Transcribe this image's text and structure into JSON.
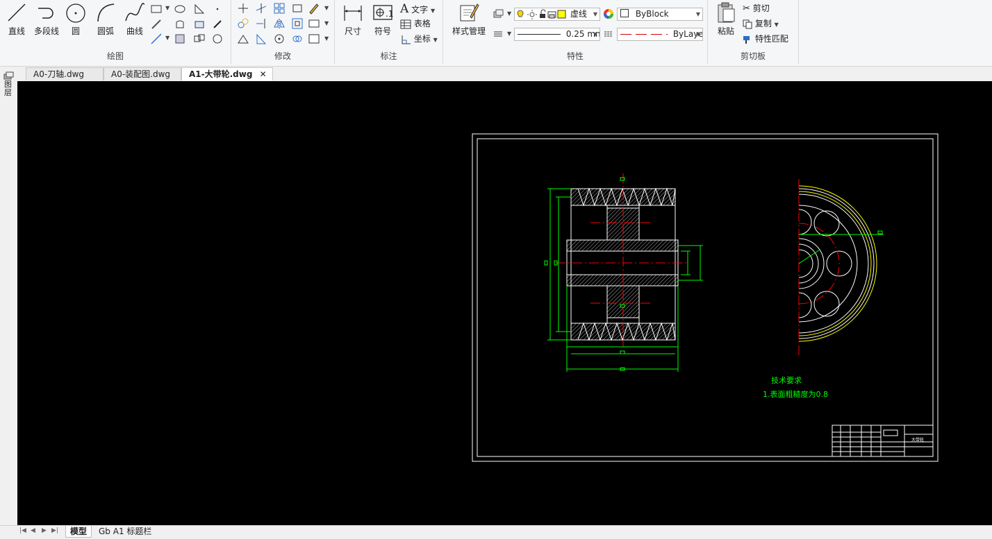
{
  "colors": {
    "ribbon_bg": "#f5f6f7",
    "canvas_bg": "#000000",
    "drawing_white": "#ffffff",
    "drawing_green": "#00ff00",
    "drawing_red": "#ff0000",
    "drawing_yellow": "#ffff00"
  },
  "ribbon": {
    "draw_group": {
      "label": "绘图",
      "buttons": [
        {
          "label": "直线",
          "icon": "line-icon"
        },
        {
          "label": "多段线",
          "icon": "polyline-icon"
        },
        {
          "label": "圆",
          "icon": "circle-icon"
        },
        {
          "label": "圆弧",
          "icon": "arc-icon"
        },
        {
          "label": "曲线",
          "icon": "spline-icon"
        }
      ]
    },
    "modify_group": {
      "label": "修改"
    },
    "annotate_group": {
      "label": "标注",
      "dimension_label": "尺寸",
      "symbol_label": "符号",
      "text_label": "文字",
      "table_label": "表格",
      "coord_label": "坐标"
    },
    "properties_group": {
      "label": "特性",
      "style_label": "样式管理",
      "layer_value": "虚线",
      "color_value": "ByBlock",
      "lineweight_value": "0.25 mn",
      "linetype_value": "ByLayer"
    },
    "clipboard_group": {
      "label": "剪切板",
      "paste_label": "粘贴",
      "cut_label": "剪切",
      "copy_label": "复制",
      "match_label": "特性匹配"
    }
  },
  "sidebar": {
    "label": "图层"
  },
  "doc_tabs": [
    {
      "label": "A0-刀轴.dwg",
      "active": false
    },
    {
      "label": "A0-装配图.dwg",
      "active": false
    },
    {
      "label": "A1-大带轮.dwg",
      "active": true
    }
  ],
  "drawing": {
    "tech_title": "技术要求",
    "tech_note": "1.表面粗糙度为0.8",
    "title_block_name": "大带轮"
  },
  "layout_tabs": [
    {
      "label": "模型",
      "active": true
    },
    {
      "label": "Gb A1 标题栏",
      "active": false
    }
  ]
}
